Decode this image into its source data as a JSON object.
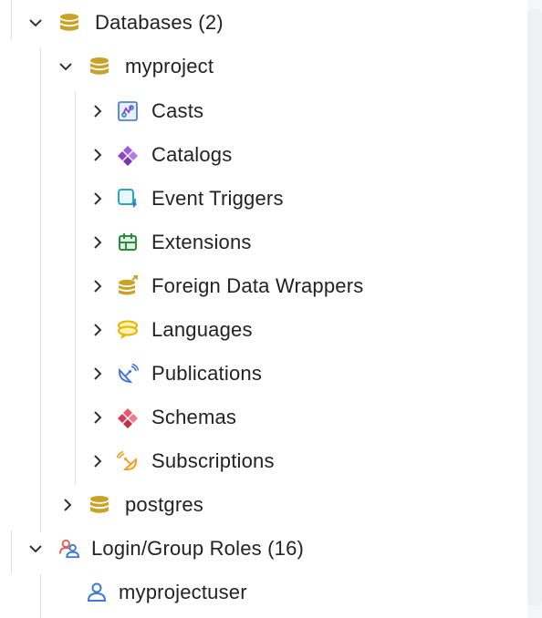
{
  "tree": {
    "databases": {
      "label": "Databases (2)",
      "expanded": true
    },
    "myproject": {
      "label": "myproject",
      "expanded": true,
      "children": [
        {
          "label": "Casts",
          "icon": "casts-icon"
        },
        {
          "label": "Catalogs",
          "icon": "catalogs-icon"
        },
        {
          "label": "Event Triggers",
          "icon": "event-triggers-icon"
        },
        {
          "label": "Extensions",
          "icon": "extensions-icon"
        },
        {
          "label": "Foreign Data Wrappers",
          "icon": "foreign-data-wrappers-icon"
        },
        {
          "label": "Languages",
          "icon": "languages-icon"
        },
        {
          "label": "Publications",
          "icon": "publications-icon"
        },
        {
          "label": "Schemas",
          "icon": "schemas-icon"
        },
        {
          "label": "Subscriptions",
          "icon": "subscriptions-icon"
        }
      ]
    },
    "postgres": {
      "label": "postgres",
      "expanded": false
    },
    "login_group_roles": {
      "label": "Login/Group Roles (16)",
      "expanded": true,
      "children": [
        {
          "label": "myprojectuser",
          "icon": "user-icon"
        }
      ]
    }
  },
  "colors": {
    "database_gold": "#c9a227",
    "role_red": "#e05a5a",
    "role_blue": "#3a7bd5",
    "accent_blue": "#3b7dd8",
    "purple": "#8e44c4",
    "green": "#2e8b3d",
    "guide_line": "#dfe3e8"
  }
}
